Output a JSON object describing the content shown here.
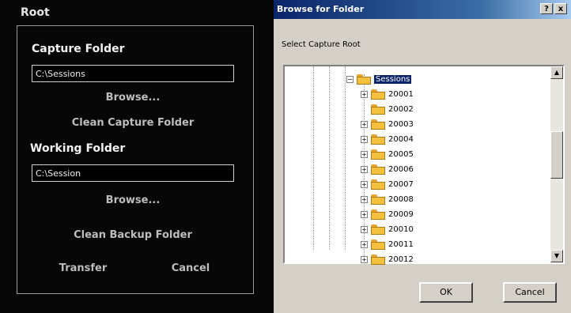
{
  "left_panel": {
    "title": "Root",
    "capture_heading": "Capture Folder",
    "capture_path": "C:\\Sessions",
    "browse1": "Browse...",
    "clean_capture": "Clean Capture Folder",
    "working_heading": "Working Folder",
    "working_path": "C:\\Session",
    "browse2": "Browse...",
    "clean_backup": "Clean Backup Folder",
    "transfer": "Transfer",
    "cancel": "Cancel"
  },
  "dialog": {
    "title": "Browse for Folder",
    "instruction": "Select Capture Root",
    "help_label": "?",
    "close_label": "x",
    "root_node": "Sessions",
    "nodes": [
      "20001",
      "20002",
      "20003",
      "20004",
      "20005",
      "20006",
      "20007",
      "20008",
      "20009",
      "20010",
      "20011",
      "20012"
    ],
    "ok_label": "OK",
    "cancel_label": "Cancel",
    "scroll_up_label": "▲",
    "scroll_down_label": "▼"
  },
  "colors": {
    "titlebar": "#0a246a",
    "dialog_bg": "#d4d0c8",
    "left_bg": "#070707",
    "folder": "#f4c040",
    "selection": "#0a246a"
  }
}
